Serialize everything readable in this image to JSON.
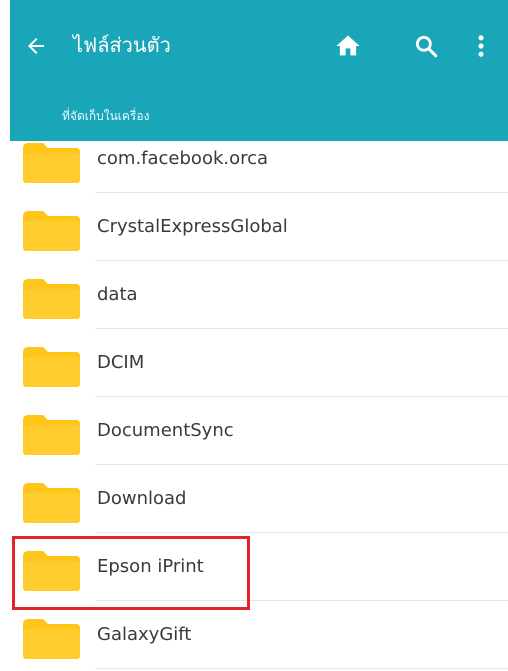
{
  "app_bar": {
    "title": "ไฟล์ส่วนตัว",
    "back_icon": "arrow-left-icon",
    "home_icon": "home-icon",
    "search_icon": "search-icon",
    "more_icon": "more-vert-icon",
    "color": "#19a6b8"
  },
  "breadcrumb": {
    "label": "ที่จัดเก็บในเครื่อง"
  },
  "folders": [
    {
      "name": "com.facebook.orca"
    },
    {
      "name": "CrystalExpressGlobal"
    },
    {
      "name": "data"
    },
    {
      "name": "DCIM"
    },
    {
      "name": "DocumentSync"
    },
    {
      "name": "Download"
    },
    {
      "name": "Epson iPrint",
      "highlighted": true
    },
    {
      "name": "GalaxyGift"
    }
  ],
  "folder_icon": "folder-icon",
  "colors": {
    "folder": "#ffc619",
    "highlight": "#e0242a"
  }
}
